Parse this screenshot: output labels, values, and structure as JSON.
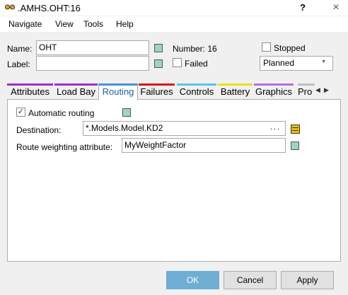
{
  "window": {
    "title": ".AMHS.OHT:16",
    "help_label": "?",
    "close_label": "×"
  },
  "menu": {
    "items": [
      "Navigate",
      "View",
      "Tools",
      "Help"
    ]
  },
  "header": {
    "name_label": "Name:",
    "name_value": "OHT",
    "label_label": "Label:",
    "label_value": "",
    "number_label": "Number: 16",
    "failed_label": "Failed",
    "failed_checked": false,
    "stopped_label": "Stopped",
    "stopped_checked": false,
    "state_value": "Planned"
  },
  "tabs": [
    {
      "label": "Attributes",
      "color": "#9b30c9",
      "active": false
    },
    {
      "label": "Load Bay",
      "color": "#9b30c9",
      "active": false
    },
    {
      "label": "Routing",
      "color": "#4a8fd6",
      "active": true
    },
    {
      "label": "Failures",
      "color": "#e01010",
      "active": false
    },
    {
      "label": "Controls",
      "color": "#52c8e8",
      "active": false
    },
    {
      "label": "Battery",
      "color": "#e8e020",
      "active": false
    },
    {
      "label": "Graphics",
      "color": "#b070e0",
      "active": false
    },
    {
      "label": "Pro",
      "color": "#c0c0c0",
      "active": false
    }
  ],
  "routing": {
    "automatic_routing_label": "Automatic routing",
    "automatic_routing_checked": true,
    "destination_label": "Destination:",
    "destination_value": "*.Models.Model.KD2",
    "destination_browse_label": "...",
    "weighting_label": "Route weighting attribute:",
    "weighting_value": "MyWeightFactor"
  },
  "buttons": {
    "ok": "OK",
    "cancel": "Cancel",
    "apply": "Apply"
  },
  "colors": {
    "accent": "#6eaed3",
    "attribute_square": "#9fd3c7",
    "edit_icon": "#f5c000"
  }
}
